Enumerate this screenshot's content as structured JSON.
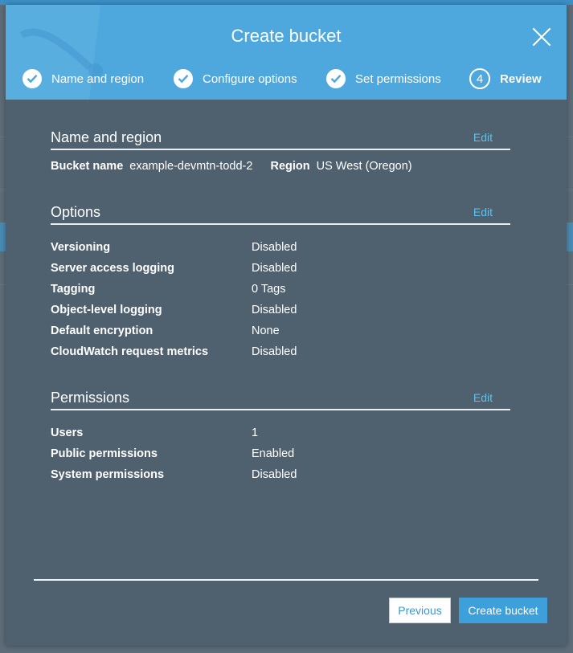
{
  "modal": {
    "title": "Create bucket",
    "steps": [
      {
        "label": "Name and region",
        "state": "complete"
      },
      {
        "label": "Configure options",
        "state": "complete"
      },
      {
        "label": "Set permissions",
        "state": "complete"
      },
      {
        "label": "Review",
        "state": "active",
        "number": "4"
      }
    ],
    "sections": {
      "name_region": {
        "title": "Name and region",
        "edit": "Edit",
        "bucket_name_label": "Bucket name",
        "bucket_name_value": "example-devmtn-todd-2",
        "region_label": "Region",
        "region_value": "US West (Oregon)"
      },
      "options": {
        "title": "Options",
        "edit": "Edit",
        "rows": [
          {
            "label": "Versioning",
            "value": "Disabled"
          },
          {
            "label": "Server access logging",
            "value": "Disabled"
          },
          {
            "label": "Tagging",
            "value": "0 Tags"
          },
          {
            "label": "Object-level logging",
            "value": "Disabled"
          },
          {
            "label": "Default encryption",
            "value": "None"
          },
          {
            "label": "CloudWatch request metrics",
            "value": "Disabled"
          }
        ]
      },
      "permissions": {
        "title": "Permissions",
        "edit": "Edit",
        "rows": [
          {
            "label": "Users",
            "value": "1"
          },
          {
            "label": "Public permissions",
            "value": "Enabled"
          },
          {
            "label": "System permissions",
            "value": "Disabled"
          }
        ]
      }
    },
    "buttons": {
      "previous": "Previous",
      "create": "Create bucket"
    }
  },
  "colors": {
    "header": "#4fa8dd",
    "body": "#4f616f",
    "link": "#5ec0ee",
    "primary_button": "#3ea0db"
  }
}
